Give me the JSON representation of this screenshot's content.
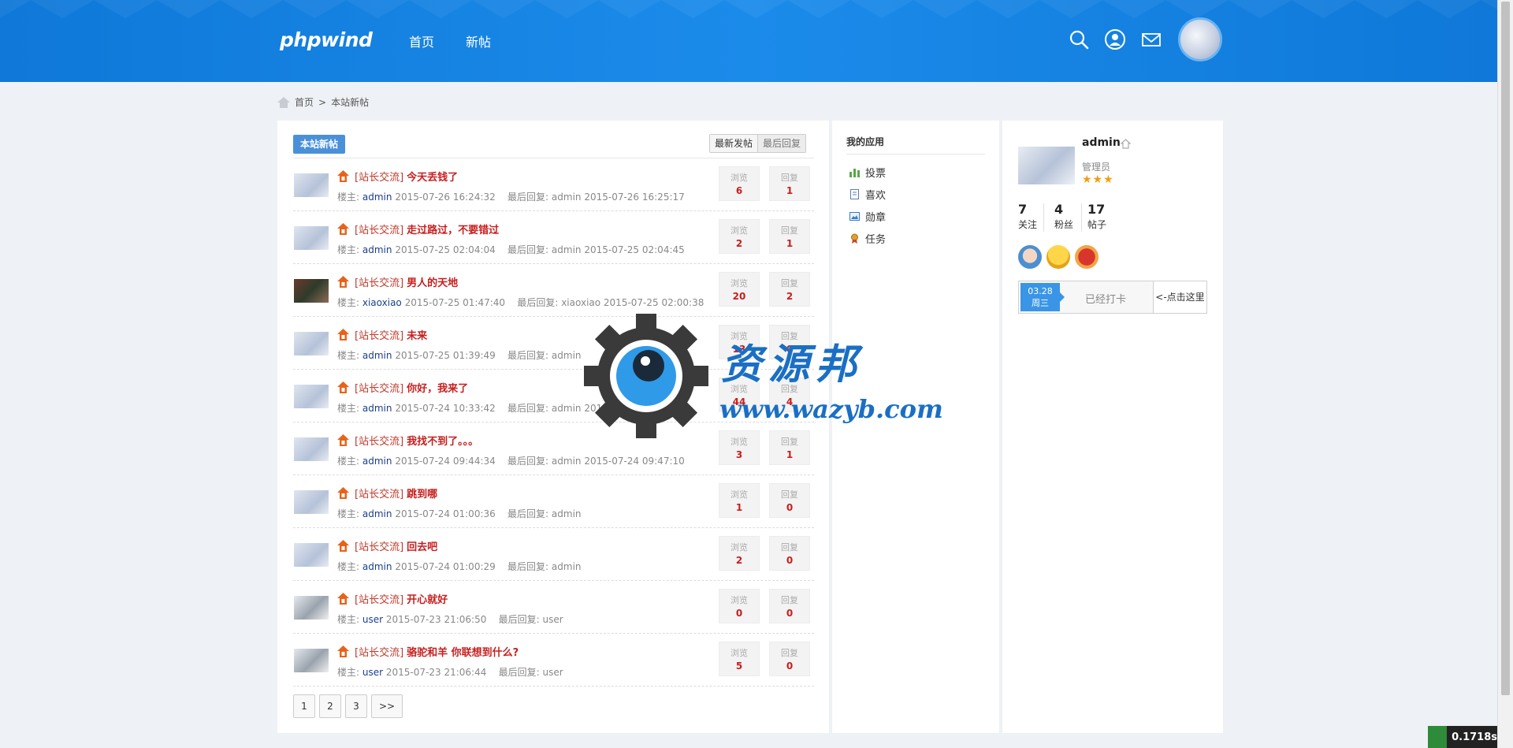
{
  "header": {
    "logo": "phpwind",
    "nav": [
      {
        "label": "首页"
      },
      {
        "label": "新帖"
      }
    ],
    "icons": [
      "search-icon",
      "user-icon",
      "mail-icon"
    ]
  },
  "breadcrumb": {
    "home": "首页",
    "separator": ">",
    "current": "本站新帖"
  },
  "list": {
    "tab_label": "本站新帖",
    "sort_latest_post": "最新发帖",
    "sort_latest_reply": "最后回复",
    "author_prefix": "楼主:",
    "reply_prefix": "最后回复:",
    "view_label": "浏览",
    "reply_label": "回复",
    "rows": [
      {
        "category": "[站长交流]",
        "title": "今天丢钱了",
        "author": "admin",
        "post_time": "2015-07-26 16:24:32",
        "last_reply": "admin 2015-07-26 16:25:17",
        "views": "6",
        "replies": "1",
        "thumb": "admin"
      },
      {
        "category": "[站长交流]",
        "title": "走过路过，不要错过",
        "author": "admin",
        "post_time": "2015-07-25 02:04:04",
        "last_reply": "admin 2015-07-25 02:04:45",
        "views": "2",
        "replies": "1",
        "thumb": "admin"
      },
      {
        "category": "[站长交流]",
        "title": "男人的天地",
        "author": "xiaoxiao",
        "post_time": "2015-07-25 01:47:40",
        "last_reply": "xiaoxiao 2015-07-25 02:00:38",
        "views": "20",
        "replies": "2",
        "thumb": "dark"
      },
      {
        "category": "[站长交流]",
        "title": "未来",
        "author": "admin",
        "post_time": "2015-07-25 01:39:49",
        "last_reply": "admin",
        "views": "13",
        "replies": "0",
        "thumb": "admin"
      },
      {
        "category": "[站长交流]",
        "title": "你好，我来了",
        "author": "admin",
        "post_time": "2015-07-24 10:33:42",
        "last_reply": "admin 2015-07-25 02:03:26",
        "views": "44",
        "replies": "4",
        "thumb": "admin"
      },
      {
        "category": "[站长交流]",
        "title": "我找不到了。。。",
        "author": "admin",
        "post_time": "2015-07-24 09:44:34",
        "last_reply": "admin 2015-07-24 09:47:10",
        "views": "3",
        "replies": "1",
        "thumb": "admin"
      },
      {
        "category": "[站长交流]",
        "title": "跳到哪",
        "author": "admin",
        "post_time": "2015-07-24 01:00:36",
        "last_reply": "admin",
        "views": "1",
        "replies": "0",
        "thumb": "admin"
      },
      {
        "category": "[站长交流]",
        "title": "回去吧",
        "author": "admin",
        "post_time": "2015-07-24 01:00:29",
        "last_reply": "admin",
        "views": "2",
        "replies": "0",
        "thumb": "admin"
      },
      {
        "category": "[站长交流]",
        "title": "开心就好",
        "author": "user",
        "post_time": "2015-07-23 21:06:50",
        "last_reply": "user",
        "views": "0",
        "replies": "0",
        "thumb": "user"
      },
      {
        "category": "[站长交流]",
        "title": "骆驼和羊 你联想到什么?",
        "author": "user",
        "post_time": "2015-07-23 21:06:44",
        "last_reply": "user",
        "views": "5",
        "replies": "0",
        "thumb": "user"
      }
    ]
  },
  "pager": {
    "pages": [
      "1",
      "2",
      "3"
    ],
    "next": ">>"
  },
  "apps": {
    "title": "我的应用",
    "items": [
      {
        "label": "投票",
        "icon": "vote-icon"
      },
      {
        "label": "喜欢",
        "icon": "like-icon"
      },
      {
        "label": "勋章",
        "icon": "medal-icon"
      },
      {
        "label": "任务",
        "icon": "task-icon"
      }
    ]
  },
  "user": {
    "name": "admin",
    "role": "管理员",
    "stars": "★★★",
    "stats": [
      {
        "value": "7",
        "label": "关注"
      },
      {
        "value": "4",
        "label": "粉丝"
      },
      {
        "value": "17",
        "label": "帖子"
      }
    ],
    "checkin": {
      "date": "03.28",
      "weekday": "周三",
      "status": "已经打卡",
      "button": "<-点击这里"
    }
  },
  "watermark": {
    "text": "资源邦",
    "url": "www.wazyb.com"
  },
  "timer": "0.1718s",
  "colors": {
    "header_bg": "#1482e3",
    "accent": "#4a90d9",
    "title_red": "#c81e1e"
  }
}
